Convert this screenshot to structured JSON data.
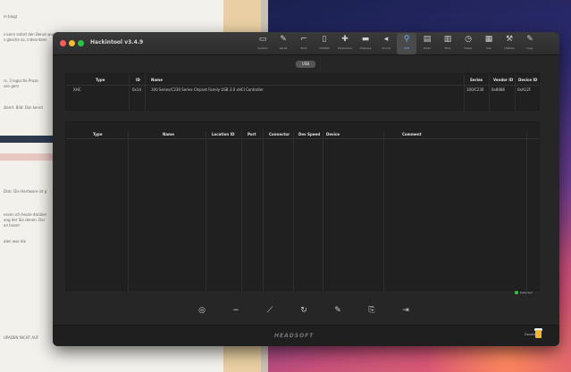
{
  "background": {
    "doc_lines": [
      "m blog)",
      "s kann sofort den Benut wurde hier bei",
      "s gleiche so, indenntzen",
      "rs, 3 logische Proze",
      "sen gern",
      "zkiert. Bild: Das kennt",
      "Disk: Die Hardware ist g",
      "essen ich heute darüber",
      "ang der Sie denen. Der",
      "an lasser",
      "alen was die"
    ],
    "doc_footer_line": "UPADEN NICHT AUF"
  },
  "window": {
    "title": "Hackintool v3.4.9",
    "toolbar": [
      {
        "label": "System",
        "icon": "monitor-icon"
      },
      {
        "label": "Serial",
        "icon": "pencil-icon"
      },
      {
        "label": "Boot",
        "icon": "boot-icon"
      },
      {
        "label": "NVRAM",
        "icon": "memory-icon"
      },
      {
        "label": "Extensions",
        "icon": "puzzle-icon"
      },
      {
        "label": "Displays",
        "icon": "display-icon"
      },
      {
        "label": "Sound",
        "icon": "speaker-icon"
      },
      {
        "label": "USB",
        "icon": "usb-icon",
        "active": true
      },
      {
        "label": "Disks",
        "icon": "disk-icon"
      },
      {
        "label": "PCIe",
        "icon": "pcie-icon"
      },
      {
        "label": "Power",
        "icon": "power-icon"
      },
      {
        "label": "Calc",
        "icon": "calculator-icon"
      },
      {
        "label": "Utilities",
        "icon": "wrench-icon"
      },
      {
        "label": "Logs",
        "icon": "logs-icon"
      }
    ],
    "tab": "USB",
    "controllers": {
      "columns": [
        "Type",
        "ID",
        "Name",
        "Series",
        "Vendor ID",
        "Device ID"
      ],
      "rows": [
        {
          "type": "XHC",
          "id": "0x14",
          "name": "100 Series/C230 Series Chipset Family USB 3.0 xHCI Controller",
          "series": "100/C230",
          "vendor": "0x8086",
          "device": "0xA12F"
        }
      ]
    },
    "ports": {
      "section_title": "USB Ports",
      "columns": [
        "Type",
        "Name",
        "Location ID",
        "Port",
        "Connector",
        "Dev Speed",
        "Device",
        "Comment"
      ]
    },
    "status_text": "Detected",
    "status_color": "#2ecc40",
    "actions": [
      "refresh-icon",
      "minus-icon",
      "broom-icon",
      "reset-icon",
      "edit-icon",
      "export-icon",
      "exit-icon"
    ],
    "footer_logo": "HEADSOFT",
    "donate_label": "Donate"
  }
}
